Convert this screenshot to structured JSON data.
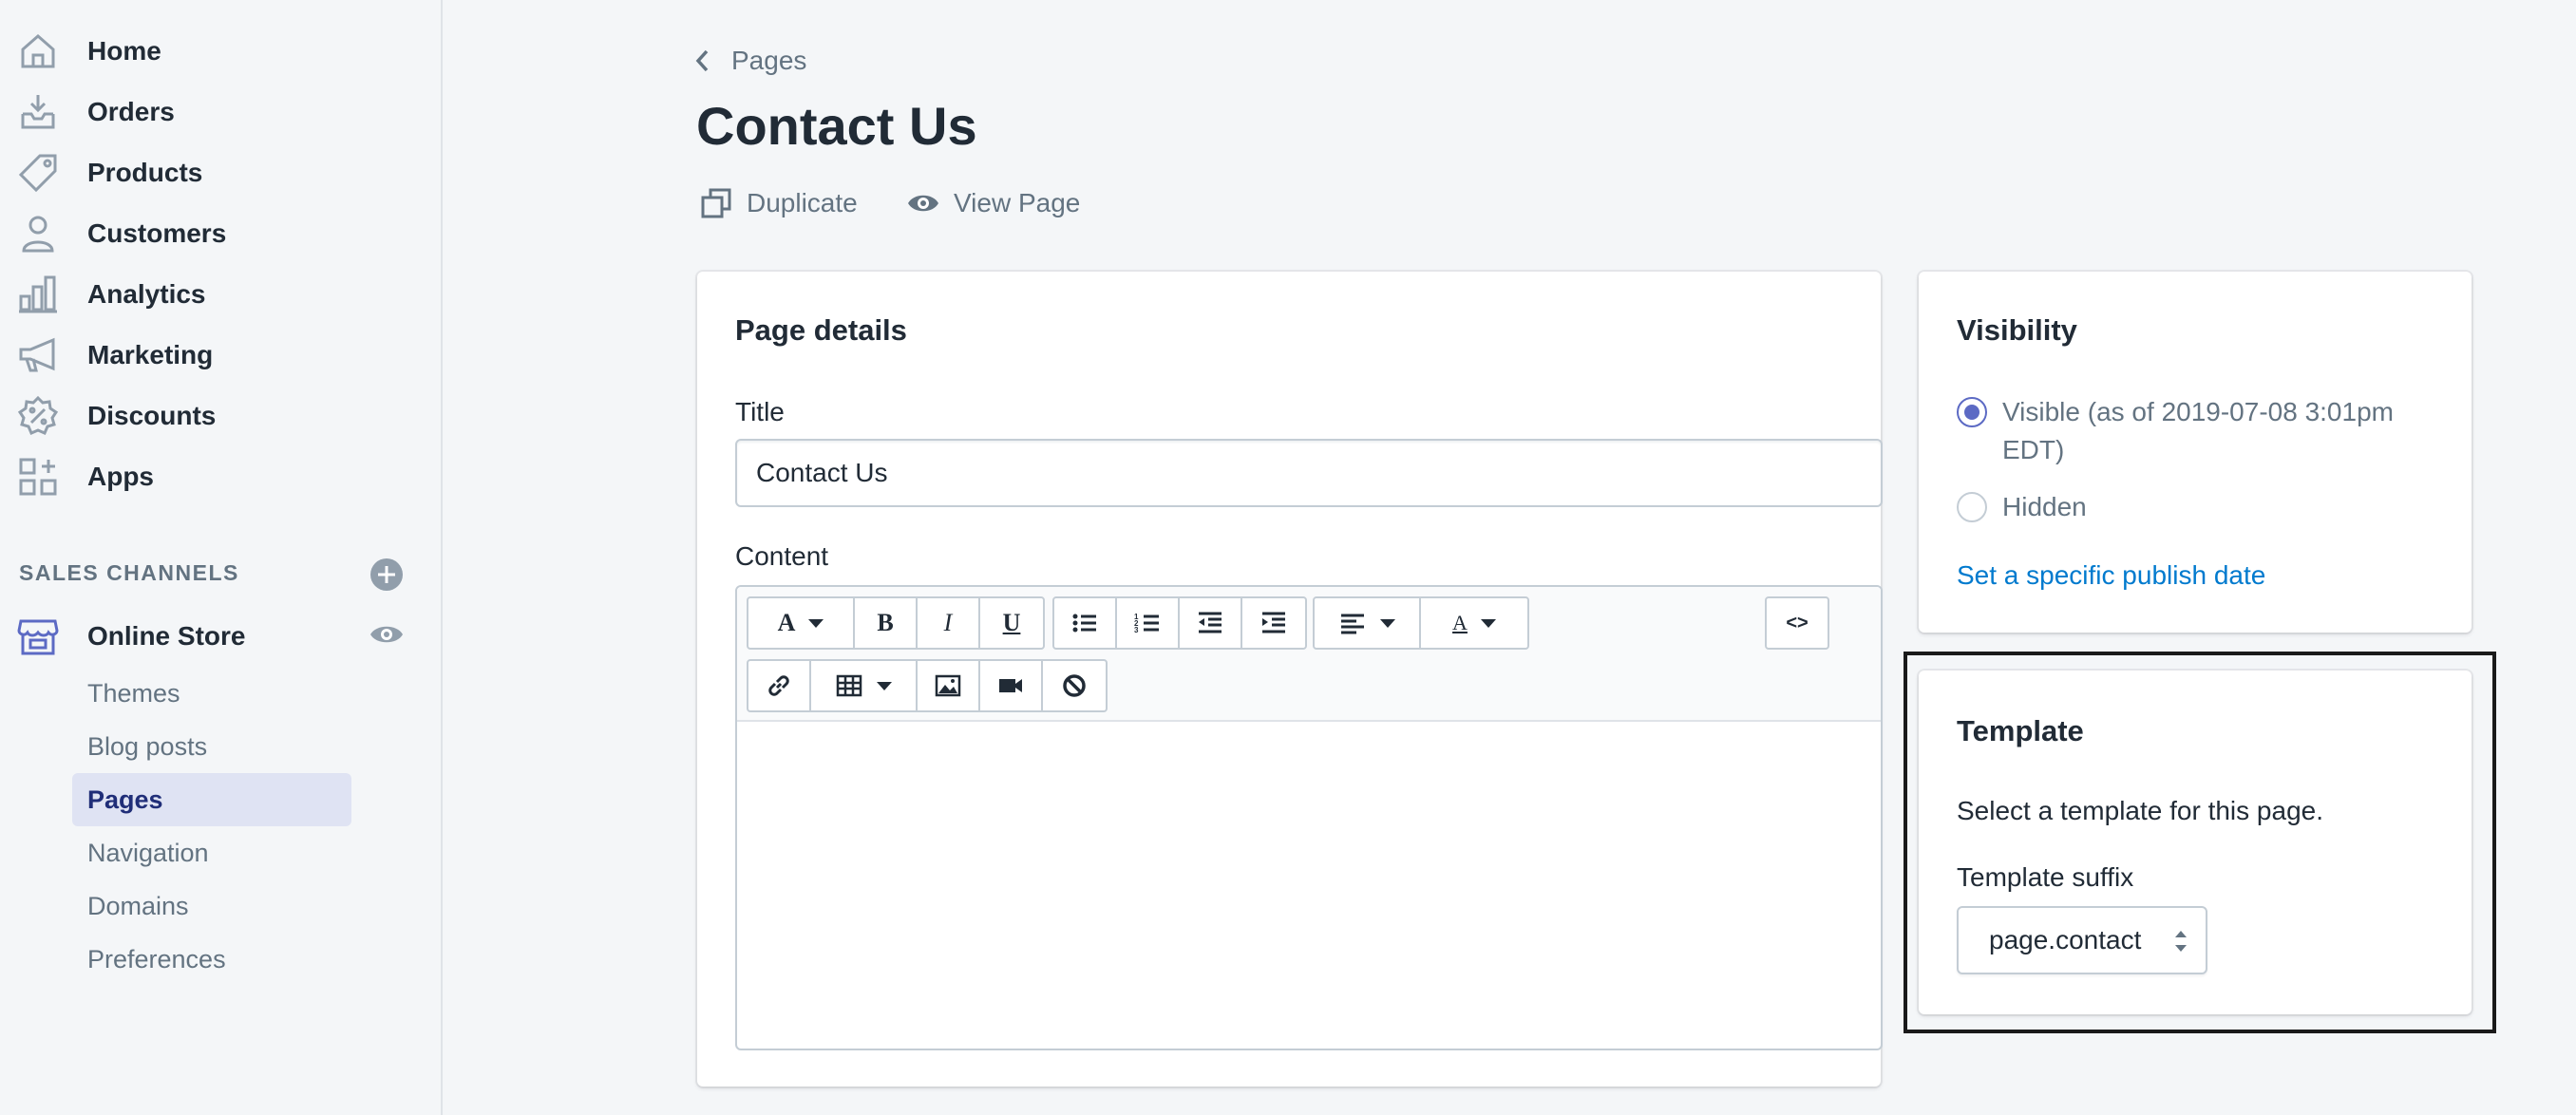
{
  "sidebar": {
    "items": [
      {
        "label": "Home",
        "icon": "home-icon"
      },
      {
        "label": "Orders",
        "icon": "orders-icon"
      },
      {
        "label": "Products",
        "icon": "tag-icon"
      },
      {
        "label": "Customers",
        "icon": "person-icon"
      },
      {
        "label": "Analytics",
        "icon": "bar-chart-icon"
      },
      {
        "label": "Marketing",
        "icon": "megaphone-icon"
      },
      {
        "label": "Discounts",
        "icon": "discount-icon"
      },
      {
        "label": "Apps",
        "icon": "apps-icon"
      }
    ],
    "sales_channels_header": "SALES CHANNELS",
    "online_store": "Online Store",
    "sub_items": [
      "Themes",
      "Blog posts",
      "Pages",
      "Navigation",
      "Domains",
      "Preferences"
    ],
    "active_sub_item": "Pages"
  },
  "header": {
    "breadcrumb": "Pages",
    "title": "Contact Us",
    "actions": {
      "duplicate": "Duplicate",
      "view_page": "View Page"
    }
  },
  "page_details": {
    "heading": "Page details",
    "title_label": "Title",
    "title_value": "Contact Us",
    "content_label": "Content",
    "toolbar_html_label": "<>"
  },
  "visibility": {
    "heading": "Visibility",
    "options": [
      {
        "label": "Visible (as of 2019-07-08 3:01pm EDT)",
        "checked": true
      },
      {
        "label": "Hidden",
        "checked": false
      }
    ],
    "publish_link": "Set a specific publish date"
  },
  "template": {
    "heading": "Template",
    "description": "Select a template for this page.",
    "suffix_label": "Template suffix",
    "suffix_value": "page.contact"
  },
  "colors": {
    "accent": "#5c6ac4",
    "link": "#007ace",
    "active_nav_bg": "#dfe3f3",
    "active_nav_text": "#202e78"
  }
}
